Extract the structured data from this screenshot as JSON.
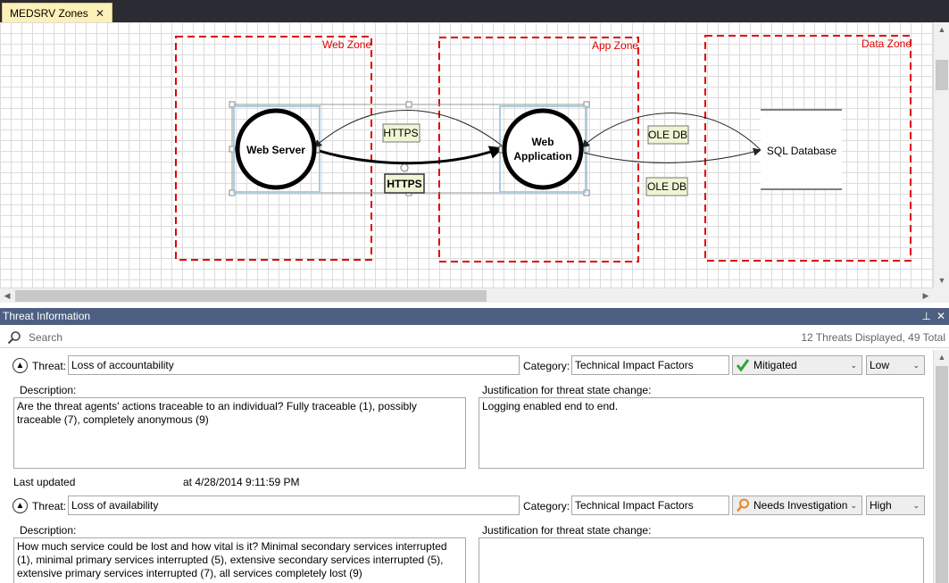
{
  "tab": {
    "title": "MEDSRV Zones",
    "close": "✕"
  },
  "diagram": {
    "zones": {
      "web": "Web Zone",
      "app": "App Zone",
      "data": "Data Zone"
    },
    "nodes": {
      "web_server": "Web Server",
      "web_app_line1": "Web",
      "web_app_line2": "Application",
      "sql_db": "SQL Database"
    },
    "flows": {
      "https_top": "HTTPS",
      "https_bottom": "HTTPS",
      "oledb_top": "OLE DB",
      "oledb_bottom": "OLE DB"
    }
  },
  "panel": {
    "title": "Threat Information",
    "pin_glyph": "⊥",
    "close_glyph": "✕",
    "search_placeholder": "Search",
    "count": "12 Threats Displayed, 49 Total"
  },
  "threats": [
    {
      "threat_label": "Threat:",
      "threat": "Loss of accountability",
      "category_label": "Category:",
      "category": "Technical Impact Factors",
      "state": "Mitigated",
      "state_icon": "check-icon",
      "priority": "Low",
      "description_label": "Description:",
      "description": "Are the threat agents' actions traceable to an individual? Fully traceable (1), possibly traceable (7), completely anonymous (9)",
      "justification_label": "Justification for threat state change:",
      "justification": "Logging enabled end to end.",
      "updated_label": "Last updated",
      "updated_at": "at 4/28/2014 9:11:59 PM"
    },
    {
      "threat_label": "Threat:",
      "threat": "Loss of availability",
      "category_label": "Category:",
      "category": "Technical Impact Factors",
      "state": "Needs Investigation",
      "state_icon": "search-icon",
      "priority": "High",
      "description_label": "Description:",
      "description": "How much service could be lost and how vital is it? Minimal secondary services interrupted (1), minimal primary services interrupted (5), extensive secondary services interrupted (5), extensive primary services interrupted (7), all services completely lost (9)",
      "justification_label": "Justification for threat state change:",
      "justification": ""
    }
  ],
  "colors": {
    "zone_border": "#e00000",
    "panel_header": "#4d6082",
    "tab_bg": "#fdf0b8",
    "flow_label_bg": "#eef5d4",
    "check_green": "#2fa52f",
    "investigate_orange": "#e8872a"
  }
}
